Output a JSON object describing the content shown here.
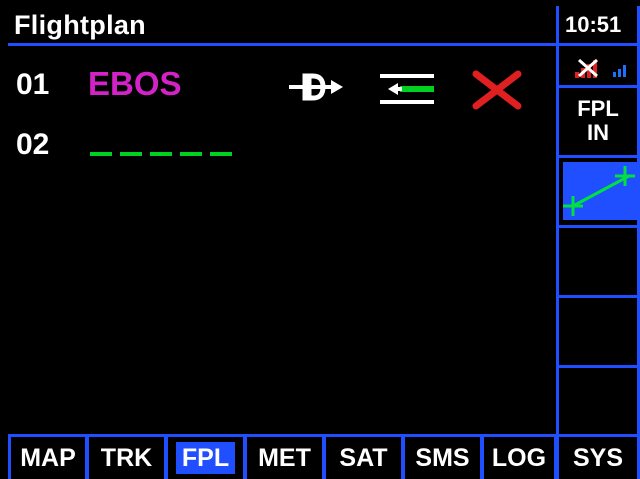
{
  "header": {
    "title": "Flightplan"
  },
  "waypoints": [
    {
      "number": "01",
      "name": "EBOS"
    },
    {
      "number": "02",
      "name": ""
    }
  ],
  "actions": {
    "direct_to_icon": "direct-to-icon",
    "insert_icon": "insert-waypoint-icon",
    "delete_icon": "delete-icon"
  },
  "status": {
    "time": "10:51",
    "mode_label_line1": "FPL",
    "mode_label_line2": "IN"
  },
  "colors": {
    "accent": "#1f4fff",
    "waypoint_active": "#d322c8",
    "waypoint_empty": "#00d020",
    "delete": "#e02020"
  },
  "tabs": [
    {
      "label": "MAP",
      "active": false
    },
    {
      "label": "TRK",
      "active": false
    },
    {
      "label": "FPL",
      "active": true
    },
    {
      "label": "MET",
      "active": false
    },
    {
      "label": "SAT",
      "active": false
    },
    {
      "label": "SMS",
      "active": false
    },
    {
      "label": "LOG",
      "active": false
    },
    {
      "label": "SYS",
      "active": false
    }
  ]
}
